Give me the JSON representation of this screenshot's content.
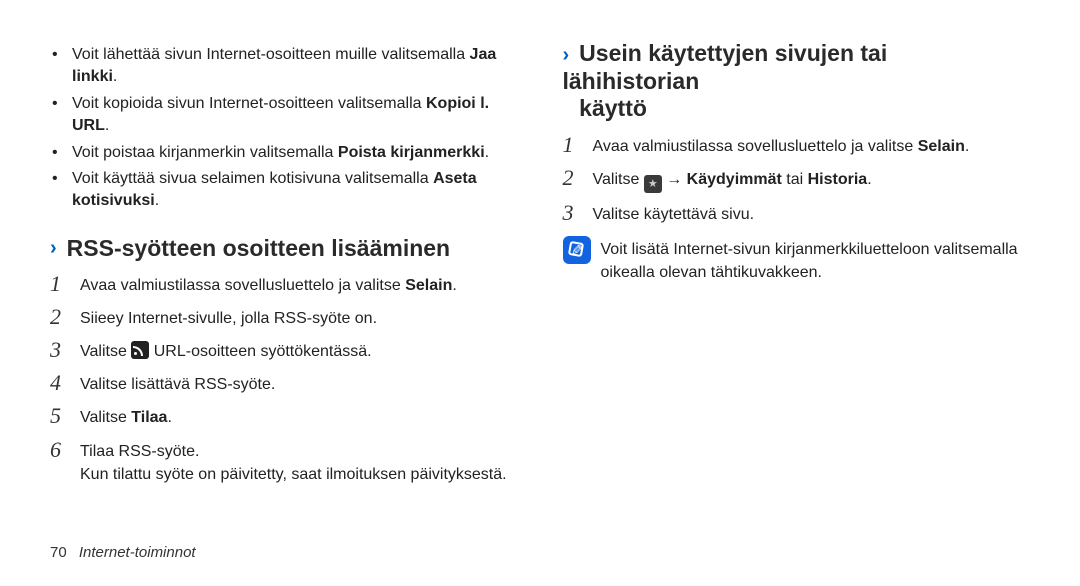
{
  "bullets": [
    {
      "pre": "Voit lähettää sivun Internet-osoitteen muille valitsemalla ",
      "bold": "Jaa linkki",
      "post": "."
    },
    {
      "pre": "Voit kopioida sivun Internet-osoitteen valitsemalla ",
      "bold": "Kopioi l. URL",
      "post": "."
    },
    {
      "pre": "Voit poistaa kirjanmerkin valitsemalla ",
      "bold": "Poista kirjanmerkki",
      "post": "."
    },
    {
      "pre": "Voit käyttää sivua selaimen kotisivuna valitsemalla ",
      "bold": "Aseta kotisivuksi",
      "post": "."
    }
  ],
  "section1": {
    "title": "RSS-syötteen osoitteen lisääminen",
    "steps": [
      {
        "num": "1",
        "pre": "Avaa valmiustilassa sovellusluettelo ja valitse ",
        "bold": "Selain",
        "post": "."
      },
      {
        "num": "2",
        "text": "Siieey Internet-sivulle, jolla RSS-syöte on."
      },
      {
        "num": "3",
        "pre": "Valitse ",
        "icon": "rss",
        "post": " URL-osoitteen syöttökentässä."
      },
      {
        "num": "4",
        "text": "Valitse lisättävä RSS-syöte."
      },
      {
        "num": "5",
        "pre": "Valitse ",
        "bold": "Tilaa",
        "post": "."
      },
      {
        "num": "6",
        "text": "Tilaa RSS-syöte.",
        "extra": "Kun tilattu syöte on päivitetty, saat ilmoituksen päivityksestä."
      }
    ]
  },
  "section2": {
    "title_line1": "Usein käytettyjen sivujen tai lähihistorian",
    "title_line2": "käyttö",
    "steps": [
      {
        "num": "1",
        "pre": "Avaa valmiustilassa sovellusluettelo ja valitse ",
        "bold": "Selain",
        "post": "."
      },
      {
        "num": "2",
        "pre": "Valitse ",
        "icon": "star",
        "mid": " → ",
        "bold": "Käydyimmät",
        "mid2": " tai ",
        "bold2": "Historia",
        "post": "."
      },
      {
        "num": "3",
        "text": "Valitse käytettävä sivu."
      }
    ],
    "note": "Voit lisätä Internet-sivun kirjanmerkkiluetteloon valitsemalla oikealla olevan tähtikuvakkeen."
  },
  "footer": {
    "page": "70",
    "title": "Internet-toiminnot"
  }
}
